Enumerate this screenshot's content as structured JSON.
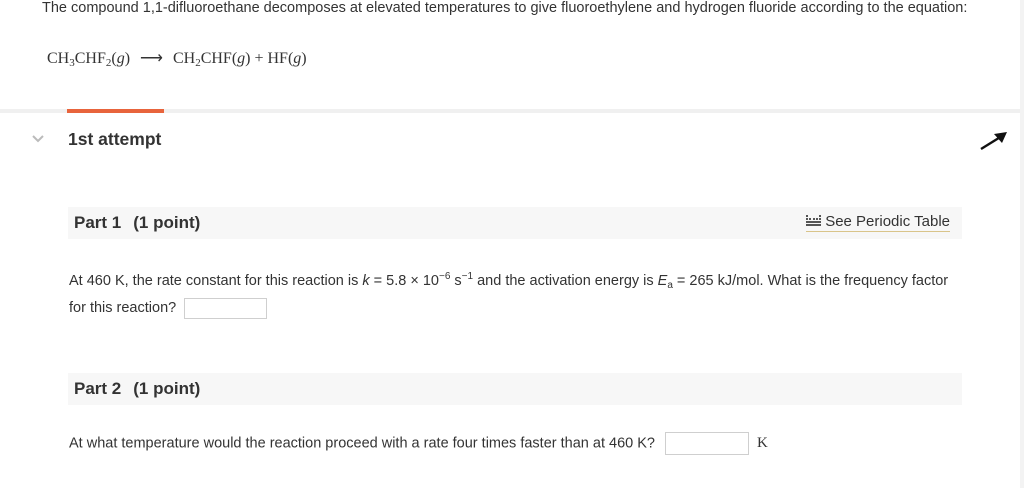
{
  "intro_text": "The compound 1,1-difluoroethane decomposes at elevated temperatures to give fluoroethylene and hydrogen fluoride according to the equation:",
  "equation": {
    "reactant": "CH3CHF2(g)",
    "arrow": "⟶",
    "product1": "CH2CHF(g)",
    "plus": "+",
    "product2": "HF(g)"
  },
  "attempt_label": "1st attempt",
  "part1": {
    "title": "Part 1",
    "points": "(1 point)",
    "periodic_link": "See Periodic Table",
    "q_a": "At 460 K, the rate constant for this reaction is ",
    "k_var": "k",
    "q_b": " = 5.8 × 10",
    "exp1": "−6",
    "q_c": " s",
    "exp2": "−1",
    "q_d": " and the activation energy is ",
    "ea_var": "E",
    "ea_sub": "a",
    "q_e": " = 265 kJ/mol. What is the frequency factor for this reaction?",
    "answer": ""
  },
  "part2": {
    "title": "Part 2",
    "points": "(1 point)",
    "question": "At what temperature would the reaction proceed with a rate four times faster than at 460 K?",
    "answer": "",
    "unit": "K"
  },
  "icons": {
    "collapse": "chevron-down-icon",
    "arrow": "collapse-arrow-icon",
    "periodic": "periodic-table-icon"
  },
  "colors": {
    "accent_tab": "#e8643c",
    "part_bar_bg": "#f7f7f7",
    "link_underline": "#d9c48a"
  }
}
